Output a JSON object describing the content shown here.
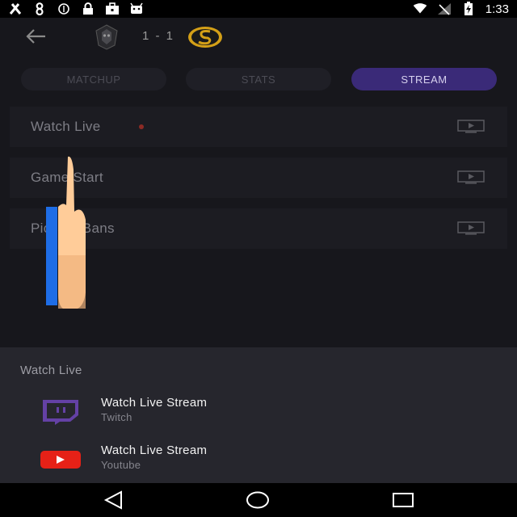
{
  "statusbar": {
    "time": "1:33",
    "left_icons": [
      "no-sim-icon",
      "eight-icon",
      "circle-icon",
      "lock-icon",
      "briefcase-icon",
      "android-icon"
    ],
    "right_icons": [
      "wifi-icon",
      "signal-off-icon",
      "battery-charging-icon"
    ]
  },
  "header": {
    "score": "1 - 1",
    "team_a_icon": "team-logo-g2-icon",
    "team_b_icon": "team-logo-splyce-icon"
  },
  "tabs": [
    {
      "label": "MATCHUP",
      "active": false
    },
    {
      "label": "STATS",
      "active": false
    },
    {
      "label": "STREAM",
      "active": true
    }
  ],
  "stream_rows": [
    {
      "label": "Watch Live",
      "live": true
    },
    {
      "label": "Game Start",
      "live": false
    },
    {
      "label": "Picks & Bans",
      "live": false
    }
  ],
  "sheet": {
    "title": "Watch Live",
    "options": [
      {
        "title": "Watch Live Stream",
        "subtitle": "Twitch",
        "icon": "twitch-icon"
      },
      {
        "title": "Watch Live Stream",
        "subtitle": "Youtube",
        "icon": "youtube-icon"
      }
    ]
  },
  "colors": {
    "accent_tab": "#3a2a78",
    "twitch": "#6441a5",
    "youtube": "#e62117",
    "live_dot": "#8c2b25"
  }
}
